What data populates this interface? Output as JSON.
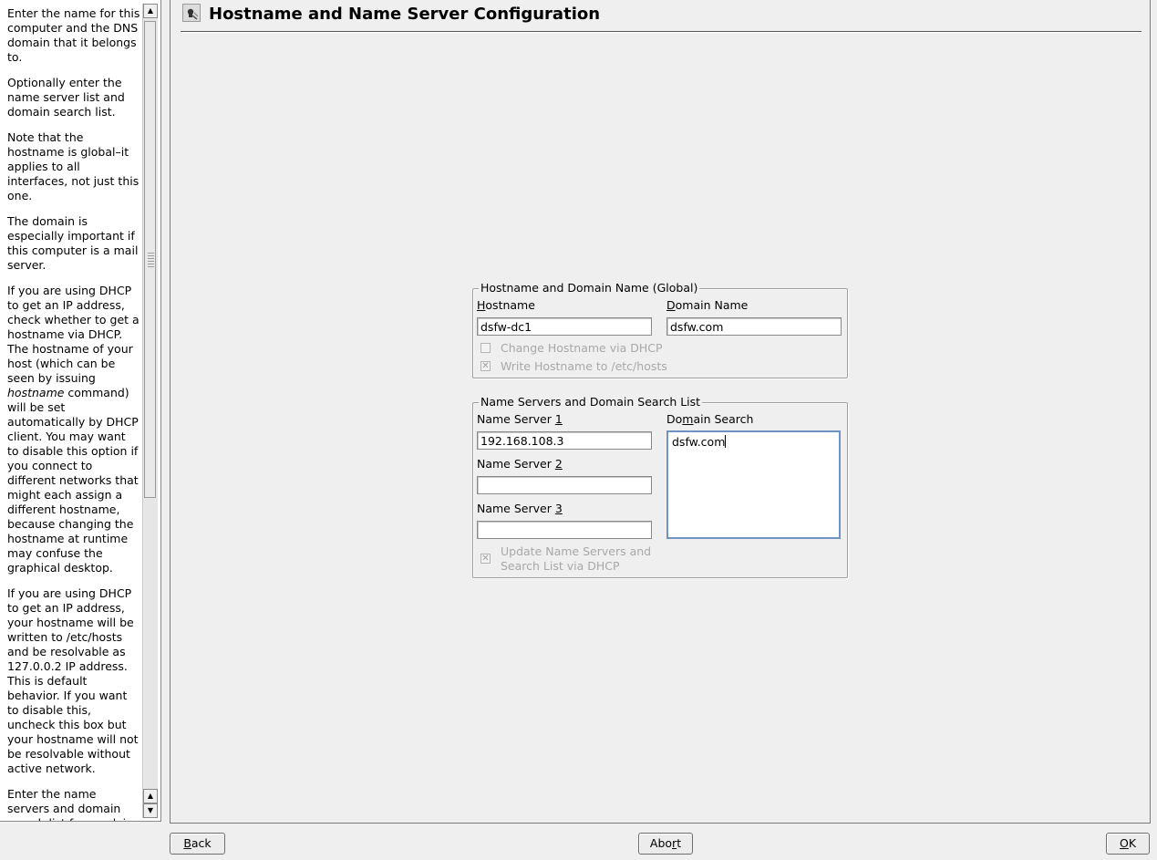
{
  "help": {
    "p1": "Enter the name for this computer and the DNS domain that it belongs to.",
    "p2": "Optionally enter the name server list and domain search list.",
    "p3": "Note that the hostname is global–it applies to all interfaces, not just this one.",
    "p4": "The domain is especially important if this computer is a mail server.",
    "p5_before": "If you are using DHCP to get an IP address, check whether to get a hostname via DHCP. The hostname of your host (which can be seen by issuing ",
    "p5_em": "hostname",
    "p5_after": " command) will be set automatically by DHCP client. You may want to disable this option if you connect to different networks that might each assign a different hostname, because changing the hostname at runtime may confuse the graphical desktop.",
    "p6": "If you are using DHCP to get an IP address, your hostname will be written to /etc/hosts and be resolvable as 127.0.0.2 IP address. This is default behavior. If you want to disable this, uncheck this box but your hostname will not be resolvable without active network.",
    "p7": "Enter the name servers and domain search list for resolving hostnames. Usually they can be obtained by DHCP."
  },
  "header": {
    "title": "Hostname and Name Server Configuration"
  },
  "global_group": {
    "title": "Hostname and Domain Name (Global)",
    "hostname_label_mnemonic": "H",
    "hostname_label_rest": "ostname",
    "hostname_value": "dsfw-dc1",
    "domain_label_mnemonic": "D",
    "domain_label_rest": "omain Name",
    "domain_value": "dsfw.com",
    "change_via_dhcp_label": "Change Hostname via DHCP",
    "change_via_dhcp_checked": false,
    "write_hosts_label": "Write Hostname to /etc/hosts",
    "write_hosts_checked": true
  },
  "ns_group": {
    "title": "Name Servers and Domain Search List",
    "ns1_label": "Name Server ",
    "ns1_mnemonic": "1",
    "ns1_value": "192.168.108.3",
    "ns2_label": "Name Server ",
    "ns2_mnemonic": "2",
    "ns2_value": "",
    "ns3_label": "Name Server ",
    "ns3_mnemonic": "3",
    "ns3_value": "",
    "search_label_a": "Do",
    "search_label_mnemonic": "m",
    "search_label_b": "ain Search",
    "search_value": "dsfw.com",
    "update_label_line1": "Update Name Servers and",
    "update_label_line2": "Search List via DHCP",
    "update_checked": true
  },
  "buttons": {
    "back_mnemonic": "B",
    "back_rest": "ack",
    "abort_a": "Abo",
    "abort_mnemonic": "r",
    "abort_b": "t",
    "ok_mnemonic": "O",
    "ok_rest": "K"
  },
  "icons": {
    "title_icon": "network-config-icon",
    "check_mark": "✕",
    "scroll_up": "▲",
    "scroll_down": "▼"
  }
}
